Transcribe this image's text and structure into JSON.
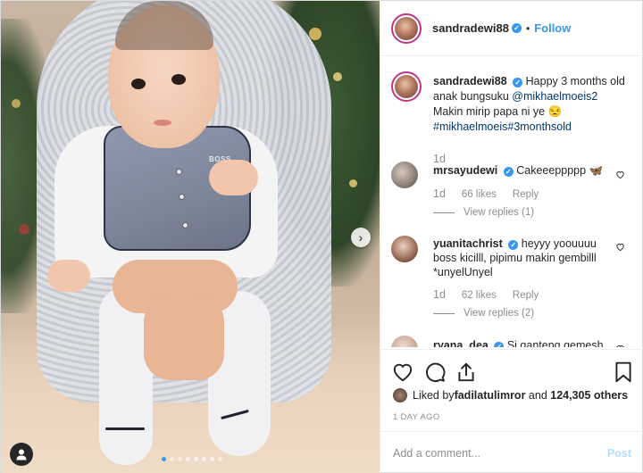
{
  "header": {
    "username": "sandradewi88",
    "separator": "•",
    "follow_label": "Follow",
    "verified_icon": "verified-badge-icon"
  },
  "caption": {
    "username": "sandradewi88",
    "text_1": "Happy 3 months old anak bungsuku ",
    "mention": "@mikhaelmoeis2",
    "text_2": "Makin mirip papa ni ye 😒",
    "hashtags": "#mikhaelmoeis#3monthsold",
    "time": "1d"
  },
  "comments": [
    {
      "username": "mrsayudewi",
      "text": "Cakeeeppppp 🦋",
      "time": "1d",
      "likes": "66 likes",
      "reply_label": "Reply",
      "view_replies": "View replies (1)"
    },
    {
      "username": "yuanitachrist",
      "text": "heyyy yoouuuu boss kicilll, pipimu makin gembilll *unyelUnyel",
      "time": "1d",
      "likes": "62 likes",
      "reply_label": "Reply",
      "view_replies": "View replies (2)"
    },
    {
      "username": "ryana_dea",
      "text": "Si ganteng gemesh"
    }
  ],
  "likes": {
    "prefix": "Liked by ",
    "user": "fadilatulimror",
    "conjunction": " and ",
    "count": "124,305 others"
  },
  "time_ago": "1 DAY AGO",
  "add_comment": {
    "placeholder": "Add a comment...",
    "post_label": "Post"
  },
  "carousel": {
    "slides": 8,
    "active_index": 0,
    "next_glyph": "›"
  },
  "colors": {
    "accent": "#3897f0",
    "text": "#262626",
    "muted": "#8e8e8e",
    "link": "#00376b",
    "post_disabled": "#b2dffc",
    "story_ring": "#c13584"
  }
}
